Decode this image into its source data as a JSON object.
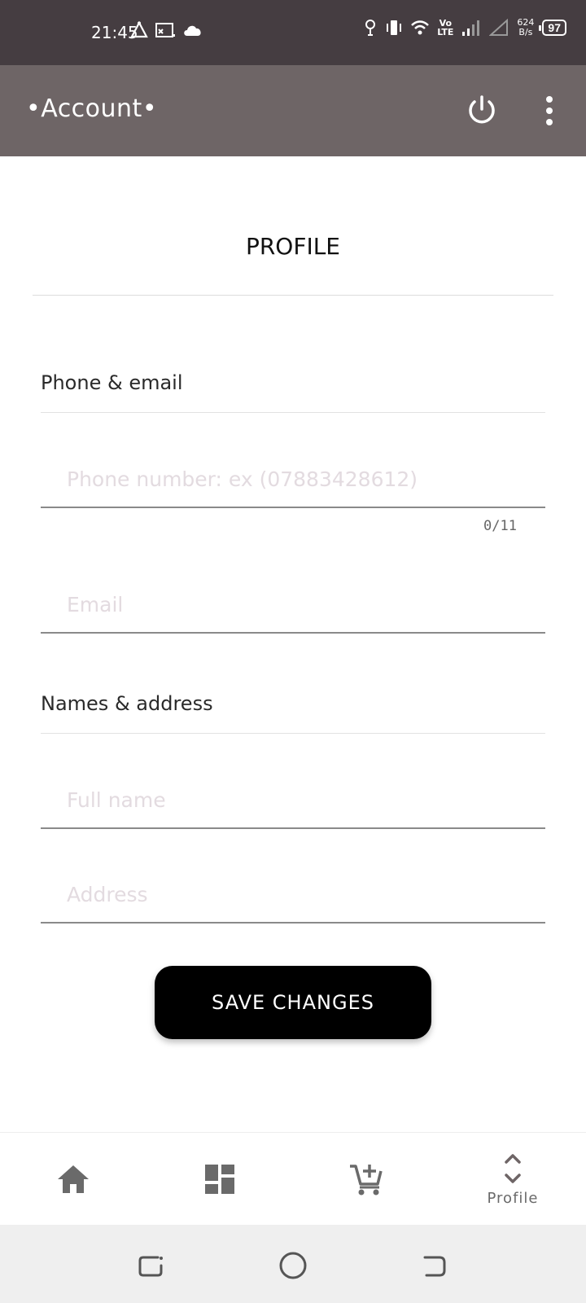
{
  "status_bar": {
    "time": "21:45",
    "net_speed_value": "624",
    "net_speed_unit": "B/s",
    "volte_top": "Vo",
    "volte_bottom": "LTE",
    "battery": "97"
  },
  "app_bar": {
    "title": "•Account•",
    "icons": [
      "power-icon",
      "more-vert-icon"
    ]
  },
  "page": {
    "heading": "PROFILE"
  },
  "sections": {
    "contact": {
      "title": "Phone & email",
      "phone_placeholder": "Phone number: ex (07883428612)",
      "phone_value": "",
      "phone_counter": "0/11",
      "email_placeholder": "Email",
      "email_value": ""
    },
    "identity": {
      "title": "Names & address",
      "fullname_placeholder": "Full name",
      "fullname_value": "",
      "address_placeholder": "Address",
      "address_value": ""
    }
  },
  "actions": {
    "save_label": "SAVE CHANGES"
  },
  "bottom_nav": {
    "items": [
      {
        "icon": "home-icon",
        "label": ""
      },
      {
        "icon": "dashboard-icon",
        "label": ""
      },
      {
        "icon": "cart-add-icon",
        "label": ""
      },
      {
        "icon": "expand-icon",
        "label": "Profile"
      }
    ],
    "active_color": "#6e6566"
  },
  "colors": {
    "status_bar": "#453d41",
    "app_bar": "#6e6566",
    "button": "#000000",
    "placeholder": "#e3dbe0"
  }
}
